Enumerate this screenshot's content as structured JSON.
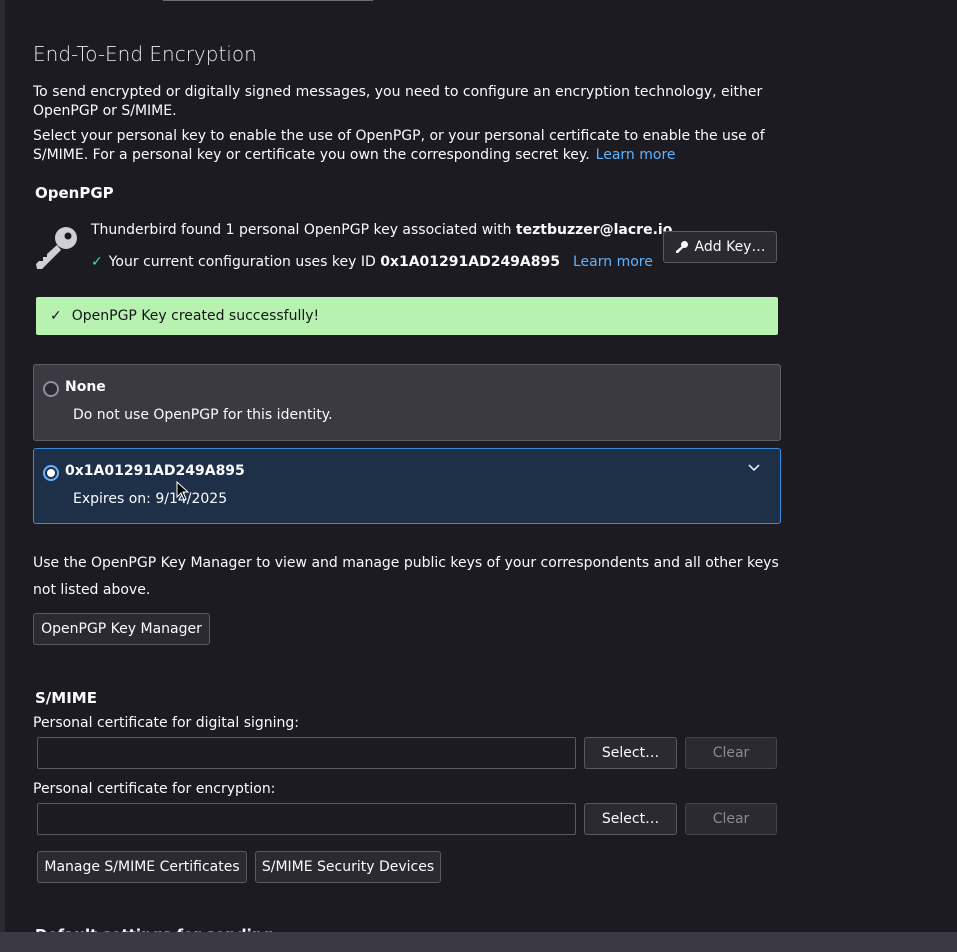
{
  "page": {
    "title": "End-To-End Encryption",
    "intro": "To send encrypted or digitally signed messages, you need to configure an encryption technology, either OpenPGP or S/MIME.",
    "select_text": "Select your personal key to enable the use of OpenPGP, or your personal certificate to enable the use of S/MIME. For a personal key or certificate you own the corresponding secret key.",
    "learn_more": "Learn more"
  },
  "openpgp": {
    "heading": "OpenPGP",
    "found_prefix": "Thunderbird found 1 personal OpenPGP key associated with ",
    "email": "teztbuzzer@lacre.io",
    "config_prefix": "Your current configuration uses key ID ",
    "key_id": "0x1A01291AD249A895",
    "learn_more": "Learn more",
    "add_key_label": "Add Key…",
    "success_message": "OpenPGP Key created successfully!",
    "options": [
      {
        "title": "None",
        "subtitle": "Do not use OpenPGP for this identity.",
        "selected": false
      },
      {
        "title": "0x1A01291AD249A895",
        "subtitle": "Expires on: 9/14/2025",
        "selected": true
      }
    ],
    "manager_text": "Use the OpenPGP Key Manager to view and manage public keys of your correspondents and all other keys not listed above.",
    "manager_button": "OpenPGP Key Manager"
  },
  "smime": {
    "heading": "S/MIME",
    "signing_label": "Personal certificate for digital signing:",
    "signing_value": "",
    "encryption_label": "Personal certificate for encryption:",
    "encryption_value": "",
    "select_label": "Select…",
    "clear_label": "Clear",
    "manage_certs_label": "Manage S/MIME Certificates",
    "security_devices_label": "S/MIME Security Devices"
  },
  "next_section": {
    "heading": "Default settings for sending"
  },
  "colors": {
    "background": "#1c1b22",
    "accent": "#5eb4ff",
    "success_bg": "#b8f2b0",
    "selected_card_bg": "#1e3048"
  }
}
